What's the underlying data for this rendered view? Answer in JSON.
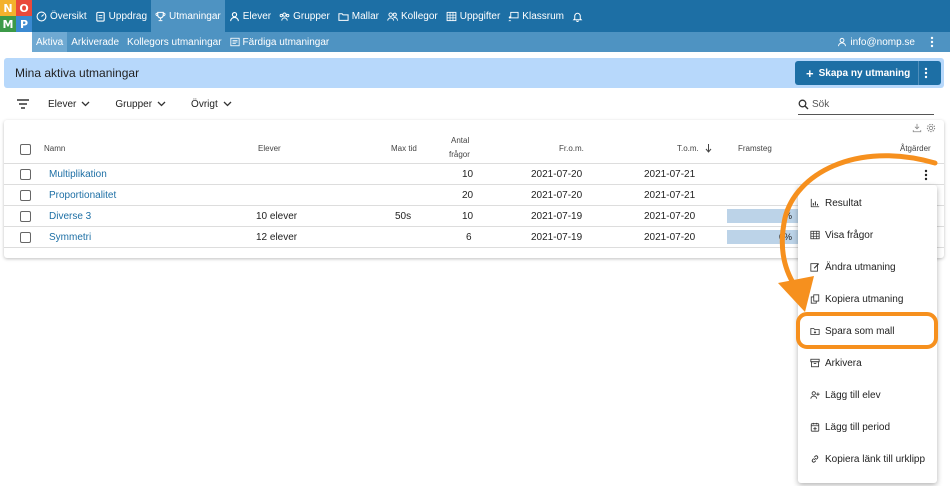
{
  "logo": {
    "letters": [
      "N",
      "O",
      "M",
      "P"
    ],
    "colors": [
      "#f3b12c",
      "#e9493c",
      "#3c9a48",
      "#3b8ad1"
    ]
  },
  "nav": {
    "items": [
      "Översikt",
      "Uppdrag",
      "Utmaningar",
      "Elever",
      "Grupper",
      "Mallar",
      "Kollegor",
      "Uppgifter",
      "Klassrum"
    ]
  },
  "subnav": {
    "items": [
      "Aktiva",
      "Arkiverade",
      "Kollegors utmaningar",
      "Färdiga utmaningar"
    ],
    "user": "info@nomp.se"
  },
  "page": {
    "title": "Mina aktiva utmaningar",
    "create_label": "Skapa ny utmaning"
  },
  "filters": {
    "items": [
      "Elever",
      "Grupper",
      "Övrigt"
    ],
    "search_placeholder": "Sök"
  },
  "table": {
    "headers": {
      "name": "Namn",
      "students": "Elever",
      "maxtime": "Max tid",
      "questions_1": "Antal",
      "questions_2": "frågor",
      "from": "Fr.o.m.",
      "to": "T.o.m.",
      "progress": "Framsteg",
      "actions": "Åtgärder"
    },
    "rows": [
      {
        "name": "Multiplikation",
        "students": "",
        "maxtime": "",
        "questions": "10",
        "from": "2021-07-20",
        "to": "2021-07-21",
        "progress": ""
      },
      {
        "name": "Proportionalitet",
        "students": "",
        "maxtime": "",
        "questions": "20",
        "from": "2021-07-20",
        "to": "2021-07-21",
        "progress": ""
      },
      {
        "name": "Diverse 3",
        "students": "10 elever",
        "maxtime": "50s",
        "questions": "10",
        "from": "2021-07-19",
        "to": "2021-07-20",
        "progress": "%"
      },
      {
        "name": "Symmetri",
        "students": "12 elever",
        "maxtime": "",
        "questions": "6",
        "from": "2021-07-19",
        "to": "2021-07-20",
        "progress": "0%"
      }
    ]
  },
  "menu": {
    "items": [
      "Resultat",
      "Visa frågor",
      "Ändra utmaning",
      "Kopiera utmaning",
      "Spara som mall",
      "Arkivera",
      "Lägg till elev",
      "Lägg till period",
      "Kopiera länk till urklipp"
    ]
  },
  "colors": {
    "nav": "#1d6fa5",
    "subnav": "#4e93c2",
    "header": "#b7d8fb",
    "annotation": "#f6901e"
  }
}
